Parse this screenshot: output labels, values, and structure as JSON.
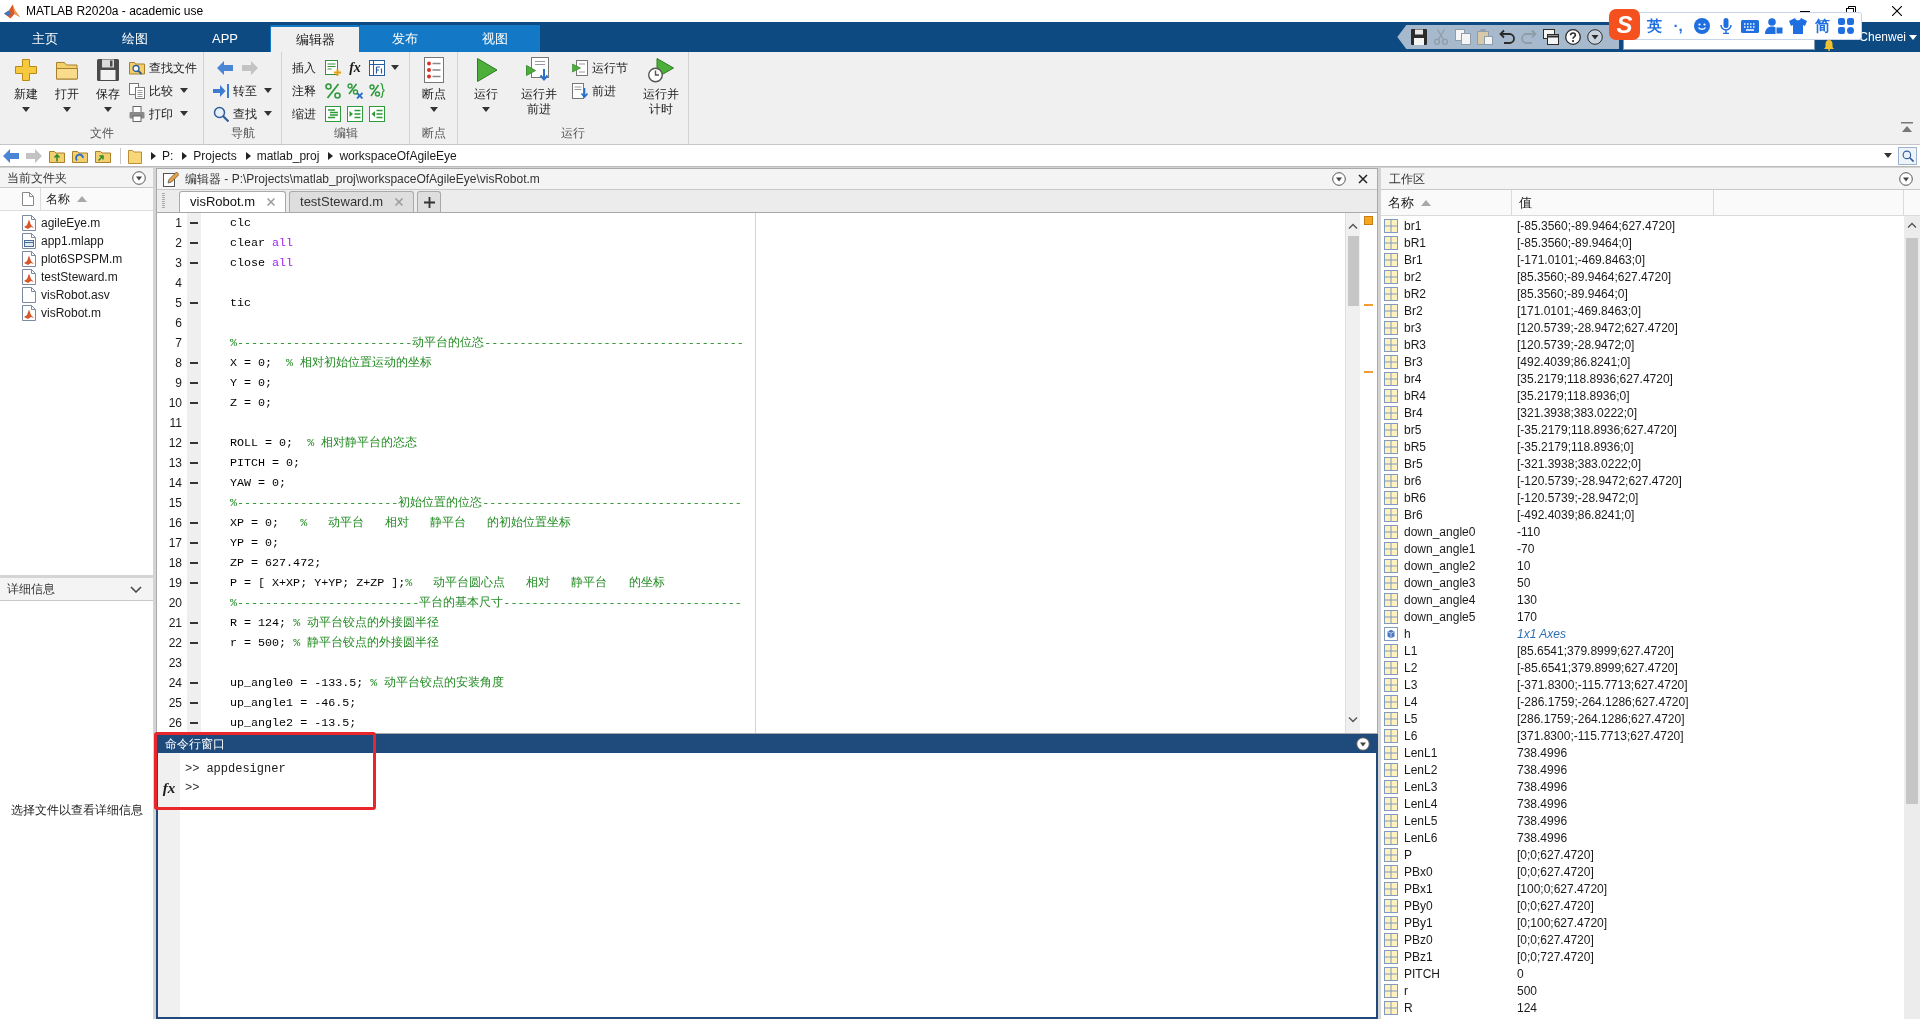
{
  "window": {
    "title": "MATLAB R2020a - academic use"
  },
  "ribbon_tabs": [
    {
      "label": "主页",
      "selected": false,
      "contextual": false
    },
    {
      "label": "绘图",
      "selected": false,
      "contextual": false
    },
    {
      "label": "APP",
      "selected": false,
      "contextual": false
    },
    {
      "label": "编辑器",
      "selected": true,
      "contextual": true
    },
    {
      "label": "发布",
      "selected": false,
      "contextual": true
    },
    {
      "label": "视图",
      "selected": false,
      "contextual": true
    }
  ],
  "quick_access_toolbar": {
    "items": [
      {
        "disabled": false
      },
      {
        "disabled": true
      },
      {
        "disabled": true
      },
      {
        "disabled": true
      },
      {
        "disabled": false
      },
      {
        "disabled": true
      },
      {
        "disabled": false
      },
      {
        "disabled": false
      },
      {
        "disabled": false
      }
    ]
  },
  "user": {
    "name": "Chenwei"
  },
  "ime_toolbar": {
    "logo": "S",
    "language": "英",
    "punctuation": "·,",
    "charset": "简"
  },
  "ribbon": {
    "groups": [
      {
        "label": "文件",
        "items": [
          {
            "kind": "large",
            "label": "新建",
            "dropdown": true
          },
          {
            "kind": "large",
            "label": "打开",
            "dropdown": true
          },
          {
            "kind": "large",
            "label": "保存",
            "dropdown": true
          },
          {
            "kind": "small",
            "label": "查找文件",
            "dropdown": false
          },
          {
            "kind": "small",
            "label": "比较",
            "dropdown": true
          },
          {
            "kind": "small",
            "label": "打印",
            "dropdown": true
          }
        ]
      },
      {
        "label": "导航",
        "items": [
          {
            "kind": "arrows",
            "forward_disabled": true
          },
          {
            "kind": "small",
            "label": "转至",
            "dropdown": true
          },
          {
            "kind": "small",
            "label": "查找",
            "dropdown": true
          }
        ]
      },
      {
        "label": "编辑",
        "items": [
          {
            "kind": "row",
            "label": "插入",
            "glyph": "fx",
            "dropdown": true
          },
          {
            "kind": "row",
            "label": "注释",
            "dropdown": false
          },
          {
            "kind": "row",
            "label": "缩进",
            "dropdown": false
          }
        ]
      },
      {
        "label": "断点",
        "items": [
          {
            "kind": "large",
            "label": "断点",
            "dropdown": true
          }
        ]
      },
      {
        "label": "运行",
        "items": [
          {
            "kind": "large",
            "label": "运行",
            "dropdown": true
          },
          {
            "kind": "large",
            "label": "运行并前进",
            "dropdown": false
          },
          {
            "kind": "small",
            "label": "运行节",
            "dropdown": false
          },
          {
            "kind": "small",
            "label": "前进",
            "dropdown": false
          },
          {
            "kind": "large",
            "label": "运行并计时",
            "dropdown": false
          }
        ]
      }
    ]
  },
  "address_bar": {
    "back_disabled": false,
    "forward_disabled": true,
    "path": [
      "P:",
      "Projects",
      "matlab_proj",
      "workspaceOfAgileEye"
    ]
  },
  "current_folder": {
    "title": "当前文件夹",
    "columns": [
      {
        "label": "名称",
        "sorted": true
      }
    ],
    "files": [
      {
        "kind": "m_file",
        "name": "agileEye.m"
      },
      {
        "kind": "app_file",
        "name": "app1.mlapp"
      },
      {
        "kind": "m_file",
        "name": "plot6SPSPM.m"
      },
      {
        "kind": "m_file",
        "name": "testSteward.m"
      },
      {
        "kind": "plain_file",
        "name": "visRobot.asv"
      },
      {
        "kind": "m_file",
        "name": "visRobot.m"
      }
    ]
  },
  "details": {
    "title": "详细信息",
    "message": "选择文件以查看详细信息"
  },
  "editor": {
    "title": "编辑器 - P:\\Projects\\matlab_proj\\workspaceOfAgileEye\\visRobot.m",
    "tabs": [
      {
        "label": "visRobot.m",
        "selected": true
      },
      {
        "label": "testSteward.m",
        "selected": false
      }
    ],
    "lines": [
      {
        "number": "1",
        "executable": true,
        "segments": [
          {
            "kind": "code",
            "text": "clc"
          }
        ]
      },
      {
        "number": "2",
        "executable": true,
        "segments": [
          {
            "kind": "code",
            "text": "clear "
          },
          {
            "kind": "keyword",
            "text": "all"
          }
        ]
      },
      {
        "number": "3",
        "executable": true,
        "segments": [
          {
            "kind": "code",
            "text": "close "
          },
          {
            "kind": "keyword",
            "text": "all"
          }
        ]
      },
      {
        "number": "4",
        "executable": false
      },
      {
        "number": "5",
        "executable": true,
        "segments": [
          {
            "kind": "code",
            "text": "tic"
          }
        ]
      },
      {
        "number": "6",
        "executable": false
      },
      {
        "number": "7",
        "executable": false,
        "segments": [
          {
            "kind": "comment",
            "text": "%-------------------------动平台的位恣-------------------------------------"
          }
        ]
      },
      {
        "number": "8",
        "executable": true,
        "segments": [
          {
            "kind": "code",
            "text": "X = 0;  "
          },
          {
            "kind": "comment",
            "text": "% 相对初始位置运动的坐标"
          }
        ]
      },
      {
        "number": "9",
        "executable": true,
        "segments": [
          {
            "kind": "code",
            "text": "Y = 0;"
          }
        ]
      },
      {
        "number": "10",
        "executable": true,
        "segments": [
          {
            "kind": "code",
            "text": "Z = 0;"
          }
        ]
      },
      {
        "number": "11",
        "executable": false
      },
      {
        "number": "12",
        "executable": true,
        "segments": [
          {
            "kind": "code",
            "text": "ROLL = 0;  "
          },
          {
            "kind": "comment",
            "text": "% 相对静平台的恣态"
          }
        ]
      },
      {
        "number": "13",
        "executable": true,
        "segments": [
          {
            "kind": "code",
            "text": "PITCH = 0;"
          }
        ]
      },
      {
        "number": "14",
        "executable": true,
        "segments": [
          {
            "kind": "code",
            "text": "YAW = 0;"
          }
        ]
      },
      {
        "number": "15",
        "executable": false,
        "segments": [
          {
            "kind": "comment",
            "text": "%-----------------------初始位置的位恣-------------------------------------"
          }
        ]
      },
      {
        "number": "16",
        "executable": true,
        "segments": [
          {
            "kind": "code",
            "text": "XP = 0;   "
          },
          {
            "kind": "comment",
            "text": "%   动平台   相对   静平台   的初始位置坐标"
          }
        ]
      },
      {
        "number": "17",
        "executable": true,
        "segments": [
          {
            "kind": "code",
            "text": "YP = 0;"
          }
        ]
      },
      {
        "number": "18",
        "executable": true,
        "segments": [
          {
            "kind": "code",
            "text": "ZP = 627.472;"
          }
        ]
      },
      {
        "number": "19",
        "executable": true,
        "segments": [
          {
            "kind": "code",
            "text": "P = [ X+XP; Y+YP; Z+ZP ];"
          },
          {
            "kind": "comment",
            "text": "%   动平台圆心点   相对   静平台   的坐标"
          }
        ]
      },
      {
        "number": "20",
        "executable": false,
        "segments": [
          {
            "kind": "comment",
            "text": "%--------------------------平台的基本尺寸----------------------------------"
          }
        ]
      },
      {
        "number": "21",
        "executable": true,
        "segments": [
          {
            "kind": "code",
            "text": "R = 124; "
          },
          {
            "kind": "comment",
            "text": "% 动平台铰点的外接圆半径"
          }
        ]
      },
      {
        "number": "22",
        "executable": true,
        "segments": [
          {
            "kind": "code",
            "text": "r = 500; "
          },
          {
            "kind": "comment",
            "text": "% 静平台铰点的外接圆半径"
          }
        ]
      },
      {
        "number": "23",
        "executable": false
      },
      {
        "number": "24",
        "executable": true,
        "segments": [
          {
            "kind": "code",
            "text": "up_angle0 = -133.5; "
          },
          {
            "kind": "comment",
            "text": "% 动平台铰点的安装角度"
          }
        ]
      },
      {
        "number": "25",
        "executable": true,
        "segments": [
          {
            "kind": "code",
            "text": "up_angle1 = -46.5;"
          }
        ]
      },
      {
        "number": "26",
        "executable": true,
        "segments": [
          {
            "kind": "code",
            "text": "up_angle2 = -13.5;"
          }
        ]
      }
    ]
  },
  "command_window": {
    "title": "命令行窗口",
    "function_glyph": "fx",
    "lines": [
      {
        "prompt": ">>",
        "text": "appdesigner"
      },
      {
        "prompt": ">>"
      }
    ]
  },
  "workspace": {
    "title": "工作区",
    "columns": [
      {
        "label": "名称",
        "sorted": true
      },
      {
        "label": "值",
        "sorted": false
      }
    ],
    "rows": [
      {
        "kind": "matrix",
        "name": "br1",
        "value": "[-85.3560;-89.9464;627.4720]"
      },
      {
        "kind": "matrix",
        "name": "bR1",
        "value": "[-85.3560;-89.9464;0]"
      },
      {
        "kind": "matrix",
        "name": "Br1",
        "value": "[-171.0101;-469.8463;0]"
      },
      {
        "kind": "matrix",
        "name": "br2",
        "value": "[85.3560;-89.9464;627.4720]"
      },
      {
        "kind": "matrix",
        "name": "bR2",
        "value": "[85.3560;-89.9464;0]"
      },
      {
        "kind": "matrix",
        "name": "Br2",
        "value": "[171.0101;-469.8463;0]"
      },
      {
        "kind": "matrix",
        "name": "br3",
        "value": "[120.5739;-28.9472;627.4720]"
      },
      {
        "kind": "matrix",
        "name": "bR3",
        "value": "[120.5739;-28.9472;0]"
      },
      {
        "kind": "matrix",
        "name": "Br3",
        "value": "[492.4039;86.8241;0]"
      },
      {
        "kind": "matrix",
        "name": "br4",
        "value": "[35.2179;118.8936;627.4720]"
      },
      {
        "kind": "matrix",
        "name": "bR4",
        "value": "[35.2179;118.8936;0]"
      },
      {
        "kind": "matrix",
        "name": "Br4",
        "value": "[321.3938;383.0222;0]"
      },
      {
        "kind": "matrix",
        "name": "br5",
        "value": "[-35.2179;118.8936;627.4720]"
      },
      {
        "kind": "matrix",
        "name": "bR5",
        "value": "[-35.2179;118.8936;0]"
      },
      {
        "kind": "matrix",
        "name": "Br5",
        "value": "[-321.3938;383.0222;0]"
      },
      {
        "kind": "matrix",
        "name": "br6",
        "value": "[-120.5739;-28.9472;627.4720]"
      },
      {
        "kind": "matrix",
        "name": "bR6",
        "value": "[-120.5739;-28.9472;0]"
      },
      {
        "kind": "matrix",
        "name": "Br6",
        "value": "[-492.4039;86.8241;0]"
      },
      {
        "kind": "matrix",
        "name": "down_angle0",
        "value": "-110"
      },
      {
        "kind": "matrix",
        "name": "down_angle1",
        "value": "-70"
      },
      {
        "kind": "matrix",
        "name": "down_angle2",
        "value": "10"
      },
      {
        "kind": "matrix",
        "name": "down_angle3",
        "value": "50"
      },
      {
        "kind": "matrix",
        "name": "down_angle4",
        "value": "130"
      },
      {
        "kind": "matrix",
        "name": "down_angle5",
        "value": "170"
      },
      {
        "kind": "axes",
        "name": "h",
        "value": "1x1 Axes"
      },
      {
        "kind": "matrix",
        "name": "L1",
        "value": "[85.6541;379.8999;627.4720]"
      },
      {
        "kind": "matrix",
        "name": "L2",
        "value": "[-85.6541;379.8999;627.4720]"
      },
      {
        "kind": "matrix",
        "name": "L3",
        "value": "[-371.8300;-115.7713;627.4720]"
      },
      {
        "kind": "matrix",
        "name": "L4",
        "value": "[-286.1759;-264.1286;627.4720]"
      },
      {
        "kind": "matrix",
        "name": "L5",
        "value": "[286.1759;-264.1286;627.4720]"
      },
      {
        "kind": "matrix",
        "name": "L6",
        "value": "[371.8300;-115.7713;627.4720]"
      },
      {
        "kind": "matrix",
        "name": "LenL1",
        "value": "738.4996"
      },
      {
        "kind": "matrix",
        "name": "LenL2",
        "value": "738.4996"
      },
      {
        "kind": "matrix",
        "name": "LenL3",
        "value": "738.4996"
      },
      {
        "kind": "matrix",
        "name": "LenL4",
        "value": "738.4996"
      },
      {
        "kind": "matrix",
        "name": "LenL5",
        "value": "738.4996"
      },
      {
        "kind": "matrix",
        "name": "LenL6",
        "value": "738.4996"
      },
      {
        "kind": "matrix",
        "name": "P",
        "value": "[0;0;627.4720]"
      },
      {
        "kind": "matrix",
        "name": "PBx0",
        "value": "[0;0;627.4720]"
      },
      {
        "kind": "matrix",
        "name": "PBx1",
        "value": "[100;0;627.4720]"
      },
      {
        "kind": "matrix",
        "name": "PBy0",
        "value": "[0;0;627.4720]"
      },
      {
        "kind": "matrix",
        "name": "PBy1",
        "value": "[0;100;627.4720]"
      },
      {
        "kind": "matrix",
        "name": "PBz0",
        "value": "[0;0;627.4720]"
      },
      {
        "kind": "matrix",
        "name": "PBz1",
        "value": "[0;0;727.4720]"
      },
      {
        "kind": "matrix",
        "name": "PITCH",
        "value": "0"
      },
      {
        "kind": "matrix",
        "name": "r",
        "value": "500"
      },
      {
        "kind": "matrix",
        "name": "R",
        "value": "124"
      }
    ]
  }
}
